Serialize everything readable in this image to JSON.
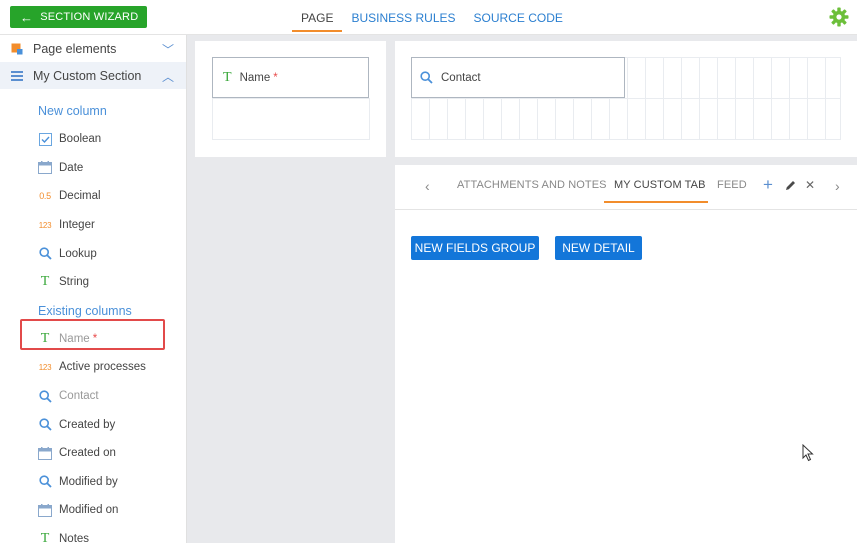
{
  "topbar": {
    "wizard_label": "SECTION WIZARD",
    "tabs": [
      {
        "label": "PAGE",
        "active": true
      },
      {
        "label": "BUSINESS RULES",
        "active": false
      },
      {
        "label": "SOURCE CODE",
        "active": false
      }
    ],
    "settings_icon": "gear-icon"
  },
  "sidebar": {
    "page_elements": "Page elements",
    "section": "My Custom Section",
    "new_columns_label": "New column",
    "new_columns": [
      {
        "label": "Boolean",
        "icon": "checkbox-icon"
      },
      {
        "label": "Date",
        "icon": "calendar-icon"
      },
      {
        "label": "Decimal",
        "icon": "decimal-icon",
        "glyph": "0.5"
      },
      {
        "label": "Integer",
        "icon": "integer-icon",
        "glyph": "123"
      },
      {
        "label": "Lookup",
        "icon": "search-icon"
      },
      {
        "label": "String",
        "icon": "text-icon",
        "glyph": "T"
      }
    ],
    "existing_columns_label": "Existing columns",
    "existing_columns": [
      {
        "label": "Name",
        "icon": "text-icon",
        "glyph": "T",
        "required": "*"
      },
      {
        "label": "Active processes",
        "icon": "integer-icon",
        "glyph": "123"
      },
      {
        "label": "Contact",
        "icon": "search-icon"
      },
      {
        "label": "Created by",
        "icon": "search-icon"
      },
      {
        "label": "Created on",
        "icon": "calendar-icon"
      },
      {
        "label": "Modified by",
        "icon": "search-icon"
      },
      {
        "label": "Modified on",
        "icon": "calendar-icon"
      },
      {
        "label": "Notes",
        "icon": "text-icon",
        "glyph": "T"
      }
    ]
  },
  "canvas": {
    "name_field": {
      "label": "Name",
      "required": "*",
      "glyph": "T"
    },
    "contact_field": {
      "label": "Contact"
    },
    "tab_strip": {
      "tabs": [
        "ATTACHMENTS AND NOTES",
        "MY CUSTOM TAB",
        "FEED"
      ],
      "active_tab": "MY CUSTOM TAB",
      "add_glyph": "+",
      "close_glyph": "✕",
      "prev_glyph": "‹",
      "next_glyph": "›"
    },
    "new_fields_group_label": "NEW FIELDS GROUP",
    "new_detail_label": "NEW DETAIL"
  },
  "colors": {
    "wizard_green": "#27a42a",
    "tab_blue": "#2b7fd0",
    "accent_orange": "#f28d2c",
    "button_blue": "#1376d9",
    "highlight_red": "#e24a4a"
  }
}
